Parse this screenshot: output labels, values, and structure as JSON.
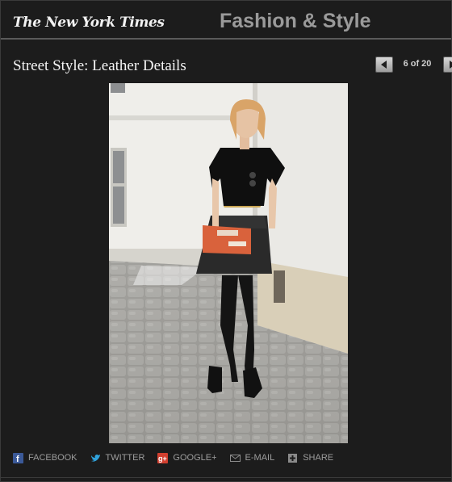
{
  "masthead": {
    "logo_text": "The New York Times",
    "section": "Fashion & Style"
  },
  "slideshow": {
    "title": "Street Style: Leather Details",
    "counter": "6 of 20",
    "prev_icon": "arrow-left-icon",
    "next_icon": "arrow-right-icon"
  },
  "share": {
    "items": [
      {
        "label": "FACEBOOK",
        "icon": "facebook-icon",
        "color": "#3b5998"
      },
      {
        "label": "TWITTER",
        "icon": "twitter-icon",
        "color": "#2fa2dc"
      },
      {
        "label": "GOOGLE+",
        "icon": "google-plus-icon",
        "color": "#d23f2f"
      },
      {
        "label": "E-MAIL",
        "icon": "email-icon",
        "color": "#8a8a8a"
      },
      {
        "label": "SHARE",
        "icon": "share-icon",
        "color": "#8a8a8a"
      }
    ]
  }
}
